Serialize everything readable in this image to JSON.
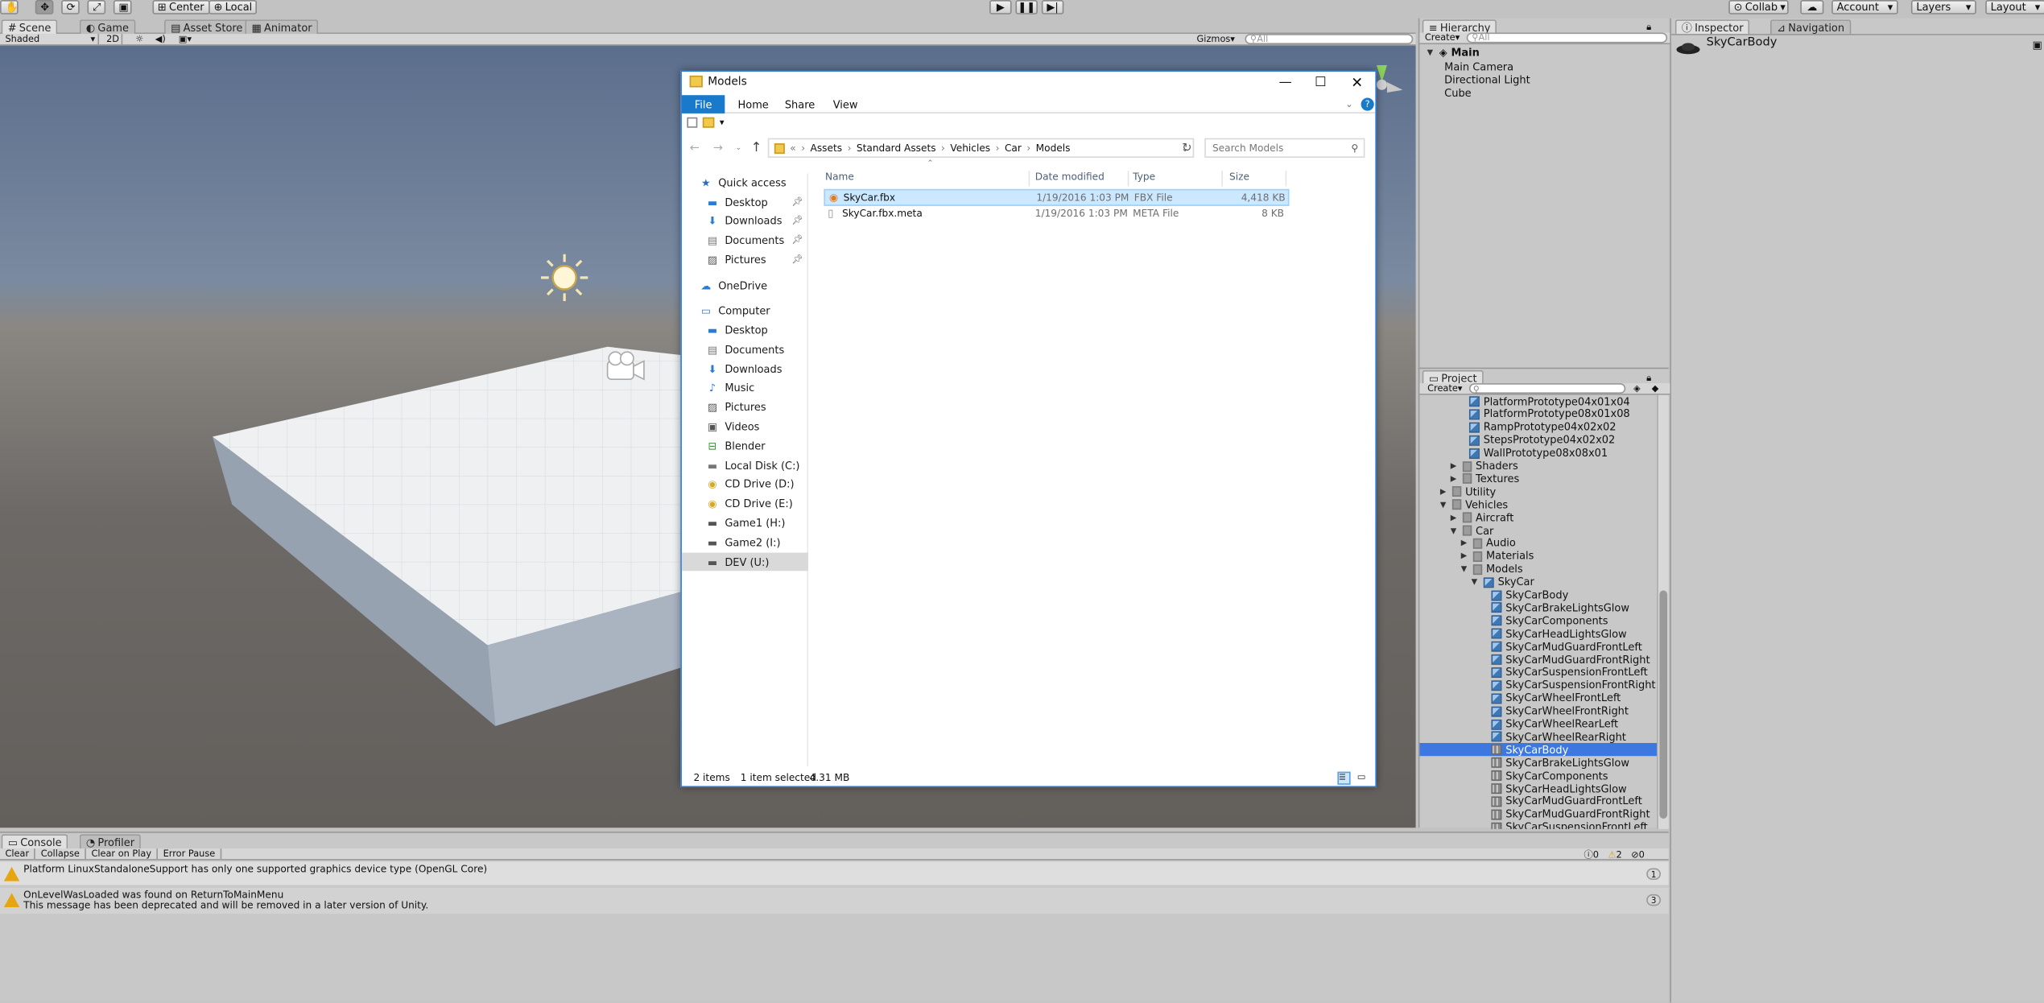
{
  "unity": {
    "toolbar": {
      "pivot_label": "Center",
      "space_label": "Local",
      "collab_label": "Collab",
      "account_label": "Account",
      "layers_label": "Layers",
      "layout_label": "Layout"
    },
    "tabs": {
      "scene": "Scene",
      "game": "Game",
      "asset_store": "Asset Store",
      "animator": "Animator",
      "hierarchy": "Hierarchy",
      "inspector": "Inspector",
      "navigation": "Navigation",
      "project": "Project",
      "console": "Console",
      "profiler": "Profiler"
    },
    "scene_toolbar": {
      "shading": "Shaded",
      "mode_2d": "2D",
      "gizmos": "Gizmos",
      "search_placeholder": "All"
    },
    "hierarchy": {
      "create_label": "Create",
      "search_placeholder": "All",
      "scene_name": "Main",
      "items": [
        "Main Camera",
        "Directional Light",
        "Cube"
      ]
    },
    "inspector": {
      "object_name": "SkyCarBody"
    },
    "project": {
      "create_label": "Create",
      "tree": [
        {
          "label": "PlatformPrototype04x01x04",
          "icon": "prefab"
        },
        {
          "label": "PlatformPrototype08x01x08",
          "icon": "prefab"
        },
        {
          "label": "RampPrototype04x02x02",
          "icon": "prefab"
        },
        {
          "label": "StepsPrototype04x02x02",
          "icon": "prefab"
        },
        {
          "label": "WallPrototype08x08x01",
          "icon": "prefab"
        },
        {
          "label": "Shaders",
          "icon": "folder"
        },
        {
          "label": "Textures",
          "icon": "folder"
        },
        {
          "label": "Utility",
          "icon": "folder"
        },
        {
          "label": "Vehicles",
          "icon": "folder"
        },
        {
          "label": "Aircraft",
          "icon": "folder"
        },
        {
          "label": "Car",
          "icon": "folder"
        },
        {
          "label": "Audio",
          "icon": "folder"
        },
        {
          "label": "Materials",
          "icon": "folder"
        },
        {
          "label": "Models",
          "icon": "folder"
        },
        {
          "label": "SkyCar",
          "icon": "model"
        },
        {
          "label": "SkyCarBody",
          "icon": "prefab"
        },
        {
          "label": "SkyCarBrakeLightsGlow",
          "icon": "prefab"
        },
        {
          "label": "SkyCarComponents",
          "icon": "prefab"
        },
        {
          "label": "SkyCarHeadLightsGlow",
          "icon": "prefab"
        },
        {
          "label": "SkyCarMudGuardFrontLeft",
          "icon": "prefab"
        },
        {
          "label": "SkyCarMudGuardFrontRight",
          "icon": "prefab"
        },
        {
          "label": "SkyCarSuspensionFrontLeft",
          "icon": "prefab"
        },
        {
          "label": "SkyCarSuspensionFrontRight",
          "icon": "prefab"
        },
        {
          "label": "SkyCarWheelFrontLeft",
          "icon": "prefab"
        },
        {
          "label": "SkyCarWheelFrontRight",
          "icon": "prefab"
        },
        {
          "label": "SkyCarWheelRearLeft",
          "icon": "prefab"
        },
        {
          "label": "SkyCarWheelRearRight",
          "icon": "prefab"
        },
        {
          "label": "SkyCarBody",
          "icon": "mesh"
        },
        {
          "label": "SkyCarBrakeLightsGlow",
          "icon": "mesh"
        },
        {
          "label": "SkyCarComponents",
          "icon": "mesh"
        },
        {
          "label": "SkyCarHeadLightsGlow",
          "icon": "mesh"
        },
        {
          "label": "SkyCarMudGuardFrontLeft",
          "icon": "mesh"
        },
        {
          "label": "SkyCarMudGuardFrontRight",
          "icon": "mesh"
        },
        {
          "label": "SkyCarSuspensionFrontLeft",
          "icon": "mesh"
        }
      ]
    },
    "console": {
      "buttons": [
        "Clear",
        "Collapse",
        "Clear on Play",
        "Error Pause"
      ],
      "counts": {
        "info": "0",
        "warning": "2",
        "error": "0"
      },
      "messages": [
        {
          "line1": "Platform LinuxStandaloneSupport has only one supported graphics device type (OpenGL Core)",
          "line2": "",
          "count": "1"
        },
        {
          "line1": "OnLevelWasLoaded was found on ReturnToMainMenu",
          "line2": "This message has been deprecated and will be removed in a later version of Unity.",
          "count": "3"
        }
      ]
    }
  },
  "explorer": {
    "title": "Models",
    "ribbon_tabs": [
      "File",
      "Home",
      "Share",
      "View"
    ],
    "breadcrumb": [
      "Assets",
      "Standard Assets",
      "Vehicles",
      "Car",
      "Models"
    ],
    "search_placeholder": "Search Models",
    "nav": [
      {
        "label": "Quick access",
        "icon": "star-icon",
        "level": 0
      },
      {
        "label": "Desktop",
        "icon": "desktop-icon",
        "level": 1,
        "pinned": true
      },
      {
        "label": "Downloads",
        "icon": "download-icon",
        "level": 1,
        "pinned": true
      },
      {
        "label": "Documents",
        "icon": "documents-icon",
        "level": 1,
        "pinned": true
      },
      {
        "label": "Pictures",
        "icon": "pictures-icon",
        "level": 1,
        "pinned": true
      },
      {
        "label": "OneDrive",
        "icon": "cloud-icon",
        "level": 0
      },
      {
        "label": "Computer",
        "icon": "computer-icon",
        "level": 0
      },
      {
        "label": "Desktop",
        "icon": "desktop-icon",
        "level": 1
      },
      {
        "label": "Documents",
        "icon": "documents-icon",
        "level": 1
      },
      {
        "label": "Downloads",
        "icon": "download-icon",
        "level": 1
      },
      {
        "label": "Music",
        "icon": "music-icon",
        "level": 1
      },
      {
        "label": "Pictures",
        "icon": "pictures-icon",
        "level": 1
      },
      {
        "label": "Videos",
        "icon": "videos-icon",
        "level": 1
      },
      {
        "label": "Blender",
        "icon": "network-drive-icon",
        "level": 1
      },
      {
        "label": "Local Disk (C:)",
        "icon": "disk-icon",
        "level": 1
      },
      {
        "label": "CD Drive (D:)",
        "icon": "cd-icon",
        "level": 1
      },
      {
        "label": "CD Drive (E:)",
        "icon": "cd-icon",
        "level": 1
      },
      {
        "label": "Game1 (H:)",
        "icon": "drive-icon",
        "level": 1
      },
      {
        "label": "Game2 (I:)",
        "icon": "drive-icon",
        "level": 1
      },
      {
        "label": "DEV (U:)",
        "icon": "drive-icon",
        "level": 1,
        "selected": true
      }
    ],
    "columns": [
      "Name",
      "Date modified",
      "Type",
      "Size"
    ],
    "files": [
      {
        "name": "SkyCar.fbx",
        "date": "1/19/2016 1:03 PM",
        "type": "FBX File",
        "size": "4,418 KB",
        "selected": true
      },
      {
        "name": "SkyCar.fbx.meta",
        "date": "1/19/2016 1:03 PM",
        "type": "META File",
        "size": "8 KB",
        "selected": false
      }
    ],
    "status": {
      "items": "2 items",
      "selected": "1 item selected",
      "size": "4.31 MB"
    }
  },
  "colors": {
    "accent": "#2b78d0",
    "unity_bg": "#c2c2c2",
    "selection": "#3d77e0",
    "explorer_selection": "#cce8ff"
  }
}
